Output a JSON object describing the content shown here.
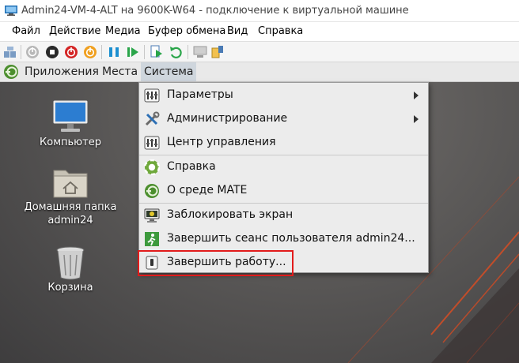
{
  "window": {
    "title": "Admin24-VM-4-ALT на 9600K-W64 - подключение к виртуальной машине",
    "app_icon": "vm-connection-icon"
  },
  "menubar": {
    "items": [
      {
        "label": "Файл"
      },
      {
        "label": "Действие"
      },
      {
        "label": "Медиа"
      },
      {
        "label": "Буфер обмена"
      },
      {
        "label": "Вид"
      },
      {
        "label": "Справка"
      }
    ]
  },
  "toolbar": {
    "buttons": [
      "ctrl-alt-del-icon",
      "start-icon",
      "turn-off-icon",
      "shutdown-icon",
      "save-icon",
      "pause-icon",
      "resume-icon",
      "checkpoint-icon",
      "revert-icon",
      "enhanced-session-icon",
      "share-icon"
    ]
  },
  "panel": {
    "menus": [
      {
        "label": "Приложения"
      },
      {
        "label": "Места"
      },
      {
        "label": "Система"
      }
    ]
  },
  "desktop": {
    "icons": [
      {
        "label": "Компьютер",
        "icon": "computer-icon"
      },
      {
        "label": "Домашняя папка",
        "label2": "admin24",
        "icon": "home-folder-icon"
      },
      {
        "label": "Корзина",
        "icon": "trash-icon"
      }
    ]
  },
  "system_menu": {
    "items": [
      {
        "label": "Параметры",
        "icon": "preferences-icon",
        "submenu": true
      },
      {
        "label": "Администрирование",
        "icon": "tools-icon",
        "submenu": true
      },
      {
        "label": "Центр управления",
        "icon": "control-center-icon",
        "submenu": false
      },
      {
        "label": "Справка",
        "icon": "help-icon",
        "submenu": false
      },
      {
        "label": "О среде MATE",
        "icon": "mate-icon",
        "submenu": false
      },
      {
        "label": "Заблокировать экран",
        "icon": "lock-screen-icon",
        "submenu": false
      },
      {
        "label": "Завершить сеанс пользователя admin24...",
        "icon": "logout-icon",
        "submenu": false
      },
      {
        "label": "Завершить работу...",
        "icon": "shutdown-icon",
        "submenu": false
      }
    ]
  },
  "colors": {
    "highlight_border": "#e21b1b",
    "panel_bg": "#e9e9e9",
    "menu_bg": "#ececec"
  }
}
